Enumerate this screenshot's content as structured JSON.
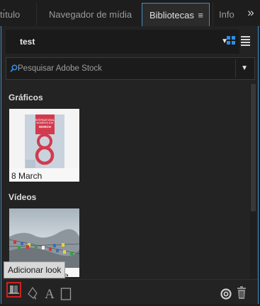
{
  "tabs": {
    "items": [
      {
        "label": "tı́tulo",
        "active": false
      },
      {
        "label": "Navegador de mídia",
        "active": false
      },
      {
        "label": "Bibliotecas",
        "active": true
      },
      {
        "label": "Info",
        "active": false
      }
    ],
    "overflow_glyph": "»",
    "menu_glyph": "≡"
  },
  "library": {
    "name": "test",
    "view_modes": [
      "grid-view-icon",
      "list-view-icon"
    ],
    "active_view": "grid"
  },
  "search": {
    "placeholder": "Pesquisar Adobe Stock"
  },
  "sections": [
    {
      "title": "Gráficos",
      "items": [
        {
          "label": "8 March",
          "thumb_text": "INTERNATIONAL WOMEN'S DAY MARCH"
        }
      ]
    },
    {
      "title": "Vídeos",
      "items": [
        {
          "label": "Time-lapse - bandeiras...",
          "visible_label": "...tre ..."
        }
      ]
    }
  ],
  "tooltip": {
    "text": "Adicionar look"
  },
  "toolbar": {
    "buttons": [
      "add-look-button",
      "add-color-button",
      "add-text-style-button",
      "add-graphic-button"
    ],
    "right_buttons": [
      "creative-cloud-sync-icon",
      "trash-icon"
    ]
  },
  "colors": {
    "accent": "#3d90c8",
    "highlight": "#d22020",
    "grid_icon": "#2d8ceb"
  }
}
